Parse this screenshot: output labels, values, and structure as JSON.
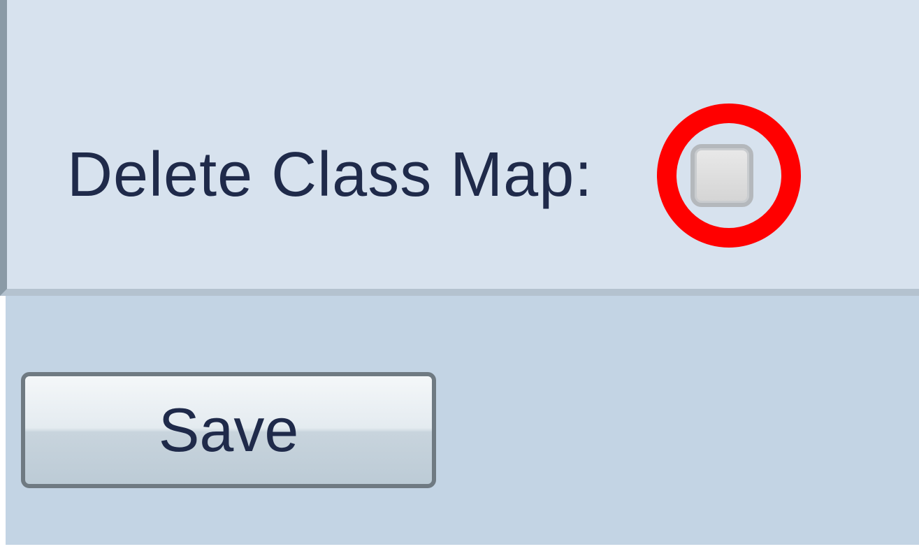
{
  "form": {
    "delete_class_map_label": "Delete Class Map:",
    "delete_class_map_checked": false
  },
  "footer": {
    "save_label": "Save"
  },
  "annotation": {
    "highlight_color": "#ff0000",
    "highlight_shape": "circle"
  },
  "colors": {
    "form_background": "#d7e2ee",
    "footer_background": "#c3d4e4",
    "text": "#1f2a4a"
  }
}
